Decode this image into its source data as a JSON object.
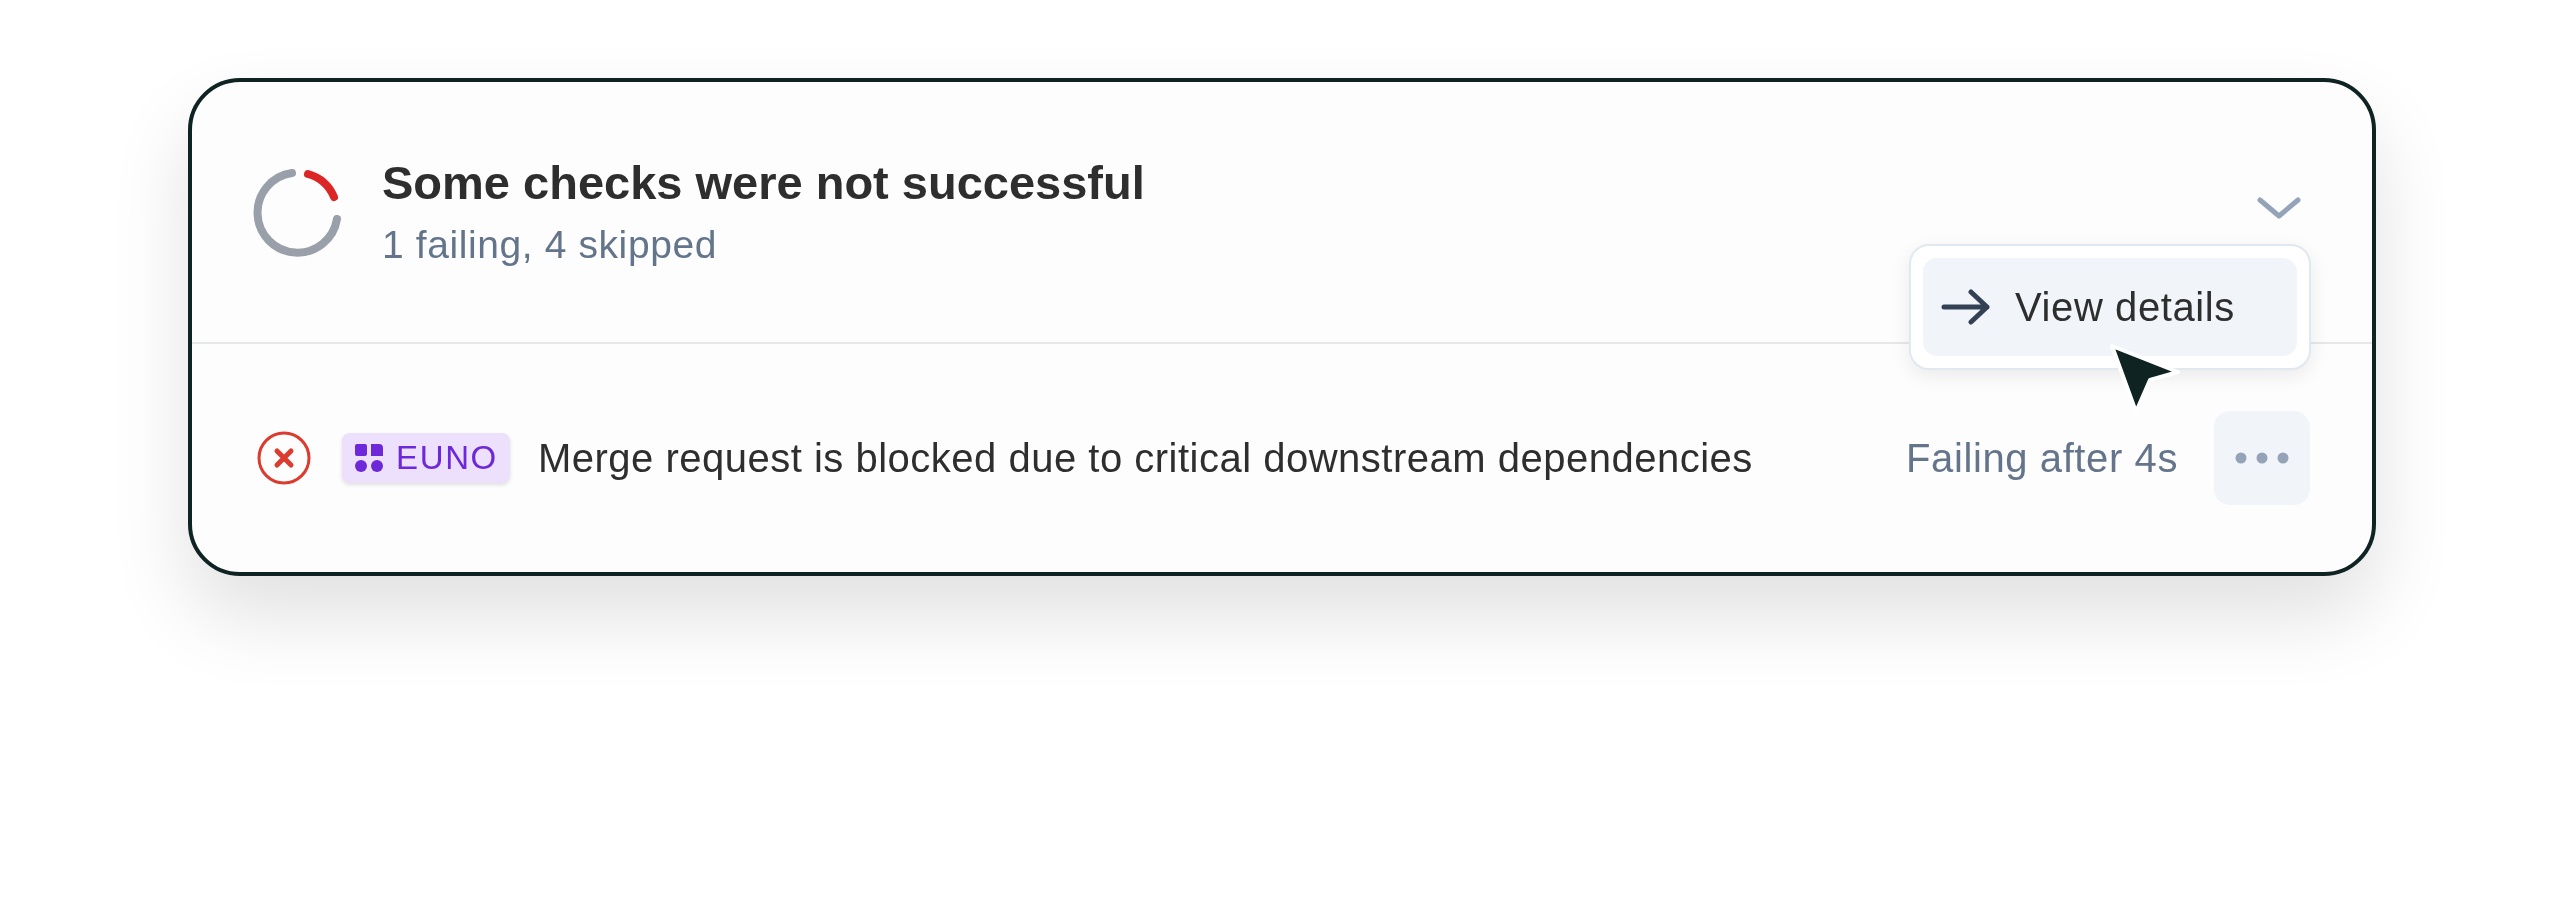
{
  "summary": {
    "title": "Some checks were not successful",
    "subtitle": "1 failing, 4 skipped"
  },
  "checks": [
    {
      "failed": true,
      "badge": "EUNO",
      "message": "Merge request is blocked due to critical downstream dependencies",
      "duration": "Failing after 4s"
    }
  ],
  "menu": {
    "items": [
      {
        "label": "View details",
        "selected": true
      }
    ]
  }
}
